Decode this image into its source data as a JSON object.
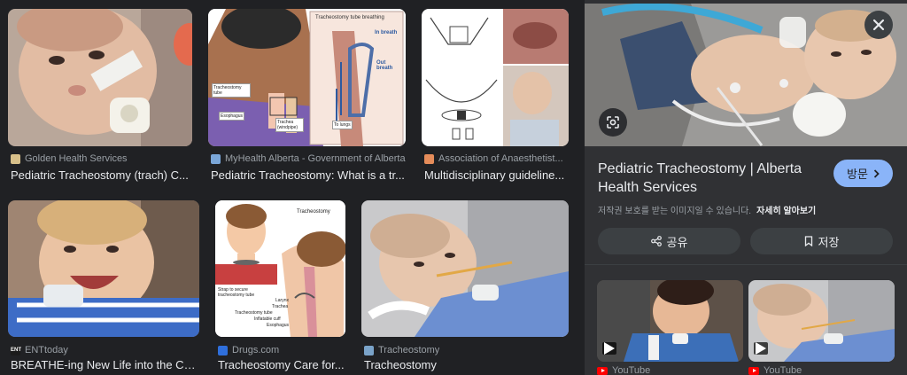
{
  "results": [
    {
      "source": "Golden Health Services",
      "title": "Pediatric Tracheostomy (trach) C..."
    },
    {
      "source": "MyHealth Alberta - Government of Alberta",
      "title": "Pediatric Tracheostomy: What is a tr..."
    },
    {
      "source": "Association of Anaesthetist...",
      "title": "Multidisciplinary guideline..."
    },
    {
      "source": "ENTtoday",
      "title": "BREATHE-ing New Life into the Ca..."
    },
    {
      "source": "Drugs.com",
      "title": "Tracheostomy Care for..."
    },
    {
      "source": "Tracheostomy",
      "title": "Tracheostomy"
    }
  ],
  "diagram1": {
    "title": "Tracheostomy tube breathing",
    "in_breath": "In breath",
    "out_breath": "Out breath",
    "tube": "Tracheostomy tube",
    "esophagus": "Esophagus",
    "trachea": "Trachea (windpipe)",
    "to_lungs": "To lungs"
  },
  "diagram2": {
    "title": "Tracheostomy",
    "strap": "Strap to secure tracheostomy tube",
    "larynx": "Larynx",
    "trachea": "Trachea",
    "tube": "Tracheostomy tube",
    "cuff": "Inflatable cuff",
    "esophagus": "Esophagus"
  },
  "panel": {
    "title": "Pediatric Tracheostomy | Alberta Health Services",
    "visit_label": "방문",
    "copyright": "저작권 보호를 받는 이미지일 수 있습니다.",
    "learn_more": "자세히 알아보기",
    "share_label": "공유",
    "save_label": "저장",
    "related": [
      {
        "source": "YouTube"
      },
      {
        "source": "YouTube"
      }
    ]
  },
  "colors": {
    "background": "#202124",
    "panel": "#303134",
    "accent": "#8ab4f8",
    "text": "#e8eaed",
    "muted": "#9aa0a6"
  },
  "icons": [
    "close-icon",
    "lens-icon",
    "chevron-right-icon",
    "share-icon",
    "bookmark-icon",
    "play-icon",
    "youtube-icon"
  ]
}
